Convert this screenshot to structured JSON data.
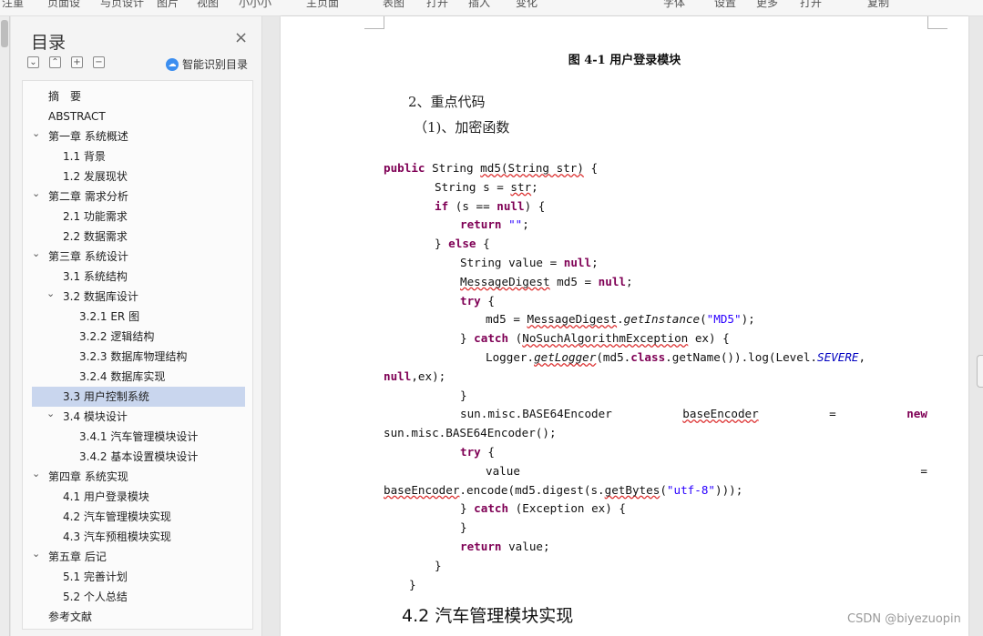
{
  "ribbon": {
    "items": [
      "注重",
      "页面设",
      "与页设计",
      "图片",
      "视图",
      "小小小",
      "主页面",
      "表图",
      "打开",
      "插入",
      "变化",
      "字体",
      "设置",
      "更多",
      "打开",
      "复制"
    ]
  },
  "nav": {
    "title": "目录",
    "close_icon": "×",
    "tools": [
      "⌄",
      "⌃",
      "+",
      "−"
    ],
    "smart_label": "智能识别目录",
    "toc": [
      {
        "label": "摘　要",
        "level": 0,
        "expand": false
      },
      {
        "label": "ABSTRACT",
        "level": 0,
        "expand": false
      },
      {
        "label": "第一章  系统概述",
        "level": 0,
        "expand": true
      },
      {
        "label": "1.1 背景",
        "level": 1,
        "expand": false
      },
      {
        "label": "1.2 发展现状",
        "level": 1,
        "expand": false
      },
      {
        "label": "第二章  需求分析",
        "level": 0,
        "expand": true
      },
      {
        "label": "2.1  功能需求",
        "level": 1,
        "expand": false
      },
      {
        "label": "2.2  数据需求",
        "level": 1,
        "expand": false
      },
      {
        "label": "第三章  系统设计",
        "level": 0,
        "expand": true
      },
      {
        "label": "3.1 系统结构",
        "level": 1,
        "expand": false
      },
      {
        "label": "3.2  数据库设计",
        "level": 1,
        "expand": true
      },
      {
        "label": "3.2.1 ER 图",
        "level": 2,
        "expand": false
      },
      {
        "label": "3.2.2  逻辑结构",
        "level": 2,
        "expand": false
      },
      {
        "label": "3.2.3  数据库物理结构",
        "level": 2,
        "expand": false
      },
      {
        "label": "3.2.4  数据库实现",
        "level": 2,
        "expand": false
      },
      {
        "label": "3.3 用户控制系统",
        "level": 1,
        "expand": false,
        "selected": true
      },
      {
        "label": "3.4 模块设计",
        "level": 1,
        "expand": true
      },
      {
        "label": "3.4.1  汽车管理模块设计",
        "level": 2,
        "expand": false
      },
      {
        "label": "3.4.2  基本设置模块设计",
        "level": 2,
        "expand": false
      },
      {
        "label": "第四章  系统实现",
        "level": 0,
        "expand": true
      },
      {
        "label": "4.1 用户登录模块",
        "level": 1,
        "expand": false
      },
      {
        "label": "4.2 汽车管理模块实现",
        "level": 1,
        "expand": false
      },
      {
        "label": "4.3 汽车预租模块实现",
        "level": 1,
        "expand": false
      },
      {
        "label": "第五章  后记",
        "level": 0,
        "expand": true
      },
      {
        "label": "5.1 完善计划",
        "level": 1,
        "expand": false
      },
      {
        "label": "5.2 个人总结",
        "level": 1,
        "expand": false
      },
      {
        "label": "参考文献",
        "level": 0,
        "expand": false
      }
    ]
  },
  "doc": {
    "figure_caption": "图 4-1  用户登录模块",
    "para1": "2、重点代码",
    "para2": "（1)、加密函数",
    "code_lines": [
      "public String md5(String str) {",
      "String s = str;",
      "if (s == null) {",
      "return \"\";",
      "} else {",
      "String value = null;",
      "MessageDigest md5 = null;",
      "try {",
      "md5 = MessageDigest.getInstance(\"MD5\");",
      "} catch (NoSuchAlgorithmException ex) {",
      "Logger.getLogger(md5.class.getName()).log(Level.SEVERE,",
      "null,ex);",
      "}",
      "sun.misc.BASE64Encoder baseEncoder = new",
      "sun.misc.BASE64Encoder();",
      "try {",
      "value =",
      "baseEncoder.encode(md5.digest(s.getBytes(\"utf-8\")));",
      "} catch (Exception ex) {",
      "}",
      "return value;",
      "}",
      "}"
    ],
    "section_heading": "4.2 汽车管理模块实现"
  },
  "watermark": "CSDN @biyezuopin"
}
